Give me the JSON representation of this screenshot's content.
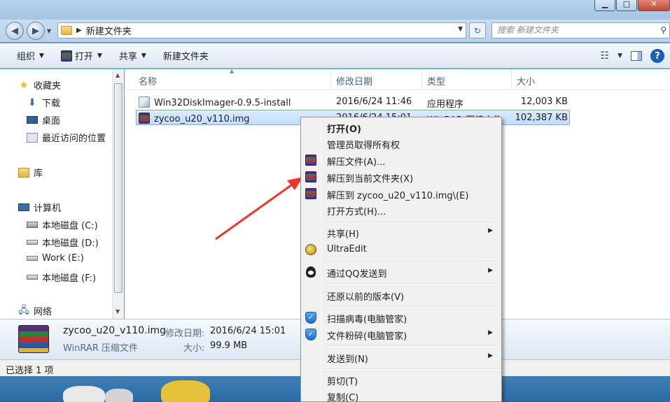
{
  "window": {
    "breadcrumb": [
      "新建文件夹"
    ],
    "search_placeholder": "搜索 新建文件夹"
  },
  "toolbar": {
    "organize": "组织",
    "open": "打开",
    "share": "共享",
    "new_folder": "新建文件夹"
  },
  "sidebar": {
    "favorites": "收藏夹",
    "favorites_items": [
      "下载",
      "桌面",
      "最近访问的位置"
    ],
    "libraries": "库",
    "computer": "计算机",
    "drives": [
      "本地磁盘 (C:)",
      "本地磁盘 (D:)",
      "Work (E:)",
      "本地磁盘 (F:)"
    ],
    "network": "网络"
  },
  "columns": {
    "name": "名称",
    "date": "修改日期",
    "type": "类型",
    "size": "大小"
  },
  "files": [
    {
      "name": "Win32DiskImager-0.9.5-install",
      "date": "2016/6/24 11:46",
      "type": "应用程序",
      "size": "12,003 KB"
    },
    {
      "name": "zycoo_u20_v110.img",
      "date": "2016/6/24 15:01",
      "type": "WinRAR 压缩文件",
      "size": "102,387 KB"
    }
  ],
  "details": {
    "filename": "zycoo_u20_v110.img",
    "modified_label": "修改日期:",
    "modified_value": "2016/6/24 15:01",
    "filetype": "WinRAR 压缩文件",
    "size_label": "大小:",
    "size_value": "99.9 MB"
  },
  "status": "已选择 1 项",
  "context_menu": {
    "items": [
      {
        "label": "打开(O)",
        "bold": true
      },
      {
        "label": "管理员取得所有权"
      },
      {
        "label": "解压文件(A)...",
        "icon": "winrar-icon"
      },
      {
        "label": "解压到当前文件夹(X)",
        "icon": "winrar-icon"
      },
      {
        "label": "解压到 zycoo_u20_v110.img\\(E)",
        "icon": "winrar-icon"
      },
      {
        "label": "打开方式(H)..."
      },
      {
        "label": "共享(H)",
        "submenu": true
      },
      {
        "label": "UltraEdit",
        "icon": "ultraedit-icon"
      },
      {
        "label": "通过QQ发送到",
        "icon": "qq-icon",
        "submenu": true
      },
      {
        "label": "还原以前的版本(V)"
      },
      {
        "label": "扫描病毒(电脑管家)",
        "icon": "shield-icon"
      },
      {
        "label": "文件粉碎(电脑管家)",
        "icon": "shield-icon",
        "submenu": true
      },
      {
        "label": "发送到(N)",
        "submenu": true
      },
      {
        "label": "剪切(T)"
      },
      {
        "label": "复制(C)"
      }
    ]
  },
  "colors": {
    "accent": "#1f5db0",
    "selection": "#c1dcfb",
    "annotation_arrow": "#e8392c"
  }
}
